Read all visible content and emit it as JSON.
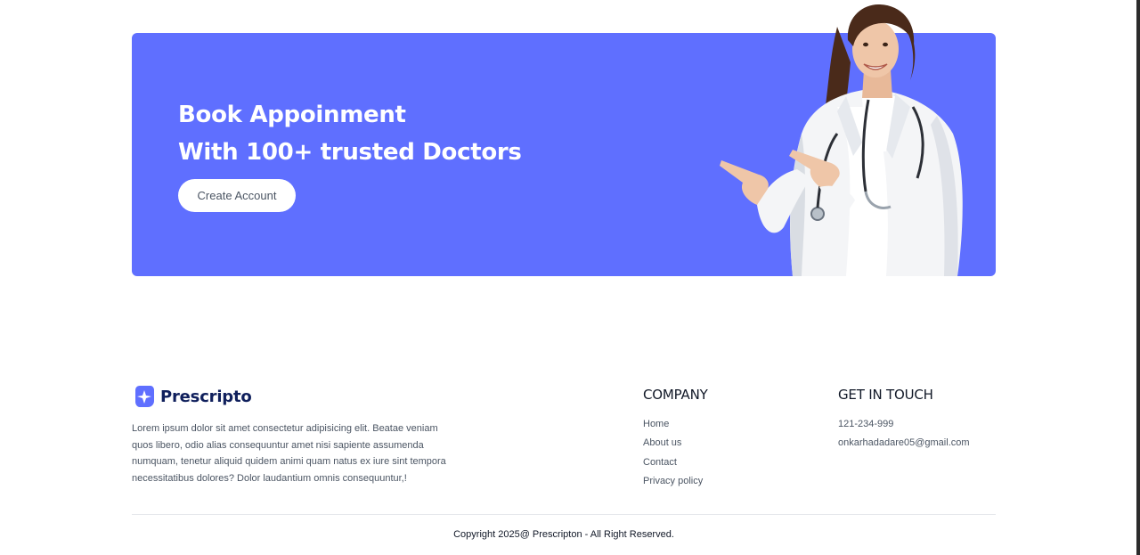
{
  "banner": {
    "title_line1": "Book Appoinment",
    "title_line2": "With 100+ trusted Doctors",
    "cta_label": "Create Account",
    "bg_color": "#5f6fff"
  },
  "footer": {
    "brand_name": "Prescripto",
    "description": "Lorem ipsum dolor sit amet consectetur adipisicing elit. Beatae veniam quos libero, odio alias consequuntur amet nisi sapiente assumenda numquam, tenetur aliquid quidem animi quam natus ex iure sint tempora necessitatibus dolores? Dolor laudantium omnis consequuntur,!",
    "company": {
      "title": "COMPANY",
      "links": [
        "Home",
        "About us",
        "Contact",
        "Privacy policy"
      ]
    },
    "contact": {
      "title": "GET IN TOUCH",
      "phone": "121-234-999",
      "email": "onkarhadadare05@gmail.com"
    },
    "copyright": "Copyright 2025@ Prescripton - All Right Reserved."
  }
}
